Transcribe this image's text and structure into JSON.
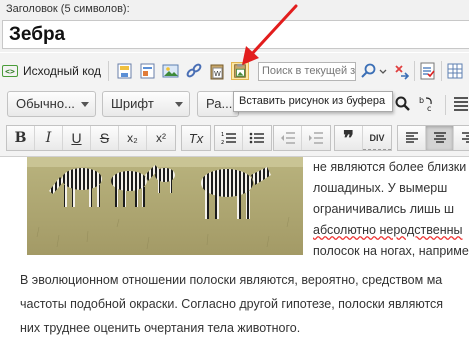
{
  "title": {
    "label": "Заголовок (5 символов):",
    "value": "Зебра"
  },
  "toolbar": {
    "source_label": "Исходный код",
    "source_icon": "source-code-icon",
    "search_placeholder": "Поиск в текущей з",
    "paste_image_tooltip": "Вставить рисунок из буфера",
    "format_combo": "Обычно...",
    "font_combo": "Шрифт",
    "size_combo": "Ра...",
    "bold": "B",
    "italic": "I",
    "underline": "U",
    "strike": "S",
    "subscript": "x₂",
    "superscript": "x²",
    "clear_format": "Tx",
    "quote": "❞",
    "div": "DIV"
  },
  "content": {
    "side_lines": [
      "не являются более близки",
      "лошадиных.  У  вымерш",
      "ограничивались  лишь  ш",
      "абсолютно  неродственны",
      "полосок на ногах, наприме"
    ],
    "paragraph_lines": [
      "В эволюционном отношении полоски являются, вероятно, средством ма",
      "частоты подобной окраски. Согласно другой гипотезе, полоски являются",
      "них труднее оценить очертания тела животного."
    ]
  },
  "colors": {
    "arrow": "#e21d1d",
    "toolbar_bg": "#f3f3f3"
  }
}
